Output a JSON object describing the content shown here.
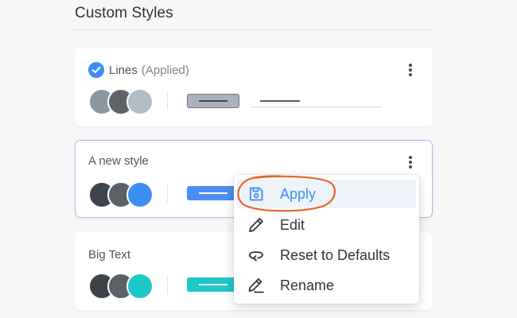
{
  "panel": {
    "title": "Custom Styles"
  },
  "colors": {
    "accent": "#3d8ef0",
    "annotation": "#e8652a",
    "teal": "#1ec8c8"
  },
  "styles": [
    {
      "name": "Lines",
      "applied_label": "(Applied)",
      "applied": true,
      "swatches": [
        "#8e979f",
        "#5f6369",
        "#b4bcc3"
      ],
      "line_button_color": "#aab3bb"
    },
    {
      "name": "A new style",
      "applied": false,
      "selected": true,
      "swatches": [
        "#3d4450",
        "#5b5f66",
        "#3d8ef0"
      ],
      "line_button_color": "#4b8ff0"
    },
    {
      "name": "Big Text",
      "applied": false,
      "swatches": [
        "#3e4249",
        "#5b5f66",
        "#1ec8c8"
      ],
      "line_button_color": "#1ec8c8"
    }
  ],
  "menu": {
    "items": [
      {
        "label": "Apply",
        "icon": "save-icon",
        "highlighted": true
      },
      {
        "label": "Edit",
        "icon": "pencil-icon"
      },
      {
        "label": "Reset to Defaults",
        "icon": "reset-icon"
      },
      {
        "label": "Rename",
        "icon": "rename-icon"
      }
    ]
  },
  "icons": {
    "applied_check": "check-circle-icon",
    "more": "more-vertical-icon"
  }
}
